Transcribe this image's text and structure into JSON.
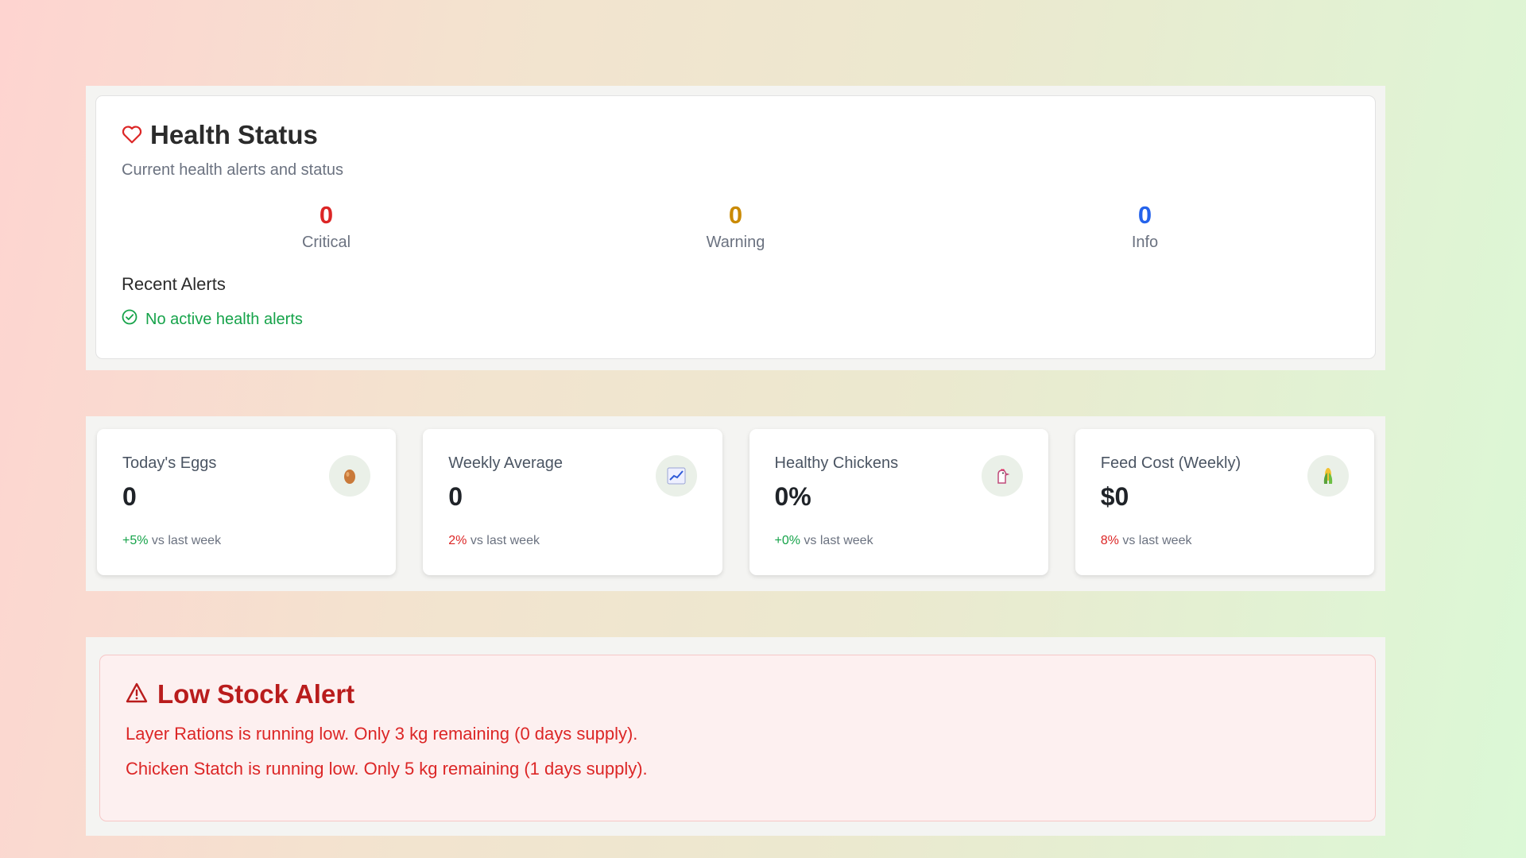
{
  "health": {
    "title": "Health Status",
    "subtitle": "Current health alerts and status",
    "counts": [
      {
        "value": "0",
        "label": "Critical",
        "color": "#dc2626"
      },
      {
        "value": "0",
        "label": "Warning",
        "color": "#ca8a04"
      },
      {
        "value": "0",
        "label": "Info",
        "color": "#2563eb"
      }
    ],
    "recent_title": "Recent Alerts",
    "recent_status": "No active health alerts"
  },
  "stats": [
    {
      "label": "Today's Eggs",
      "value": "0",
      "change": "+5%",
      "change_dir": "pos",
      "suffix": "vs last week",
      "icon": "egg-icon"
    },
    {
      "label": "Weekly Average",
      "value": "0",
      "change": "2%",
      "change_dir": "neg",
      "suffix": "vs last week",
      "icon": "chart-increasing-icon"
    },
    {
      "label": "Healthy Chickens",
      "value": "0%",
      "change": "+0%",
      "change_dir": "pos",
      "suffix": "vs last week",
      "icon": "chicken-icon"
    },
    {
      "label": "Feed Cost (Weekly)",
      "value": "$0",
      "change": "8%",
      "change_dir": "neg",
      "suffix": "vs last week",
      "icon": "corn-icon"
    }
  ],
  "stock_alert": {
    "title": "Low Stock Alert",
    "lines": [
      "Layer Rations is running low. Only 3 kg remaining (0 days supply).",
      "Chicken Statch is running low. Only 5 kg remaining (1 days supply)."
    ]
  }
}
